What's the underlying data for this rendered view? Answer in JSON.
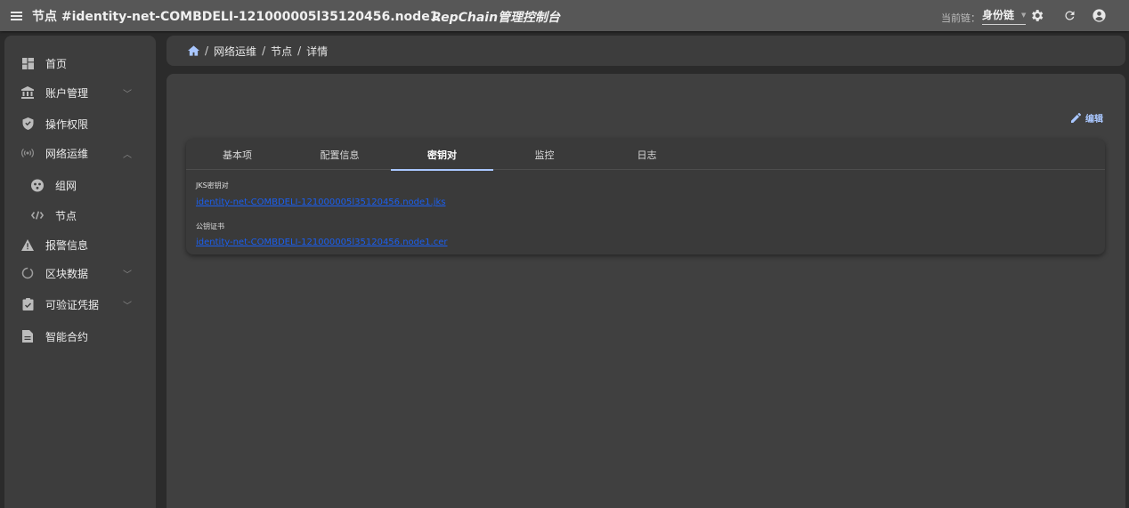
{
  "header": {
    "title": "节点 #identity-net-COMBDELI-121000005l35120456.node1",
    "brand": "RepChain管理控制台",
    "chain_label": "当前链：",
    "chain_value": "身份链"
  },
  "sidebar": {
    "items": [
      {
        "label": "首页",
        "icon": "dashboard-icon"
      },
      {
        "label": "账户管理",
        "icon": "bank-icon",
        "expandable": true
      },
      {
        "label": "操作权限",
        "icon": "shield-icon"
      },
      {
        "label": "网络运维",
        "icon": "broadcast-icon",
        "expandable": true,
        "expanded": true
      },
      {
        "label": "组网",
        "icon": "network-icon",
        "sub": true
      },
      {
        "label": "节点",
        "icon": "node-icon",
        "sub": true
      },
      {
        "label": "报警信息",
        "icon": "warning-icon"
      },
      {
        "label": "区块数据",
        "icon": "circle-icon",
        "expandable": true
      },
      {
        "label": "可验证凭据",
        "icon": "clipboard-check-icon",
        "expandable": true
      },
      {
        "label": "智能合约",
        "icon": "document-icon"
      }
    ]
  },
  "breadcrumb": [
    "网络运维",
    "节点",
    "详情"
  ],
  "content": {
    "edit_label": "编辑",
    "tabs": [
      "基本项",
      "配置信息",
      "密钥对",
      "监控",
      "日志"
    ],
    "active_tab": 2,
    "fields": [
      {
        "label": "JKS密钥对",
        "value": "identity-net-COMBDELI-121000005l35120456.node1.jks"
      },
      {
        "label": "公钥证书",
        "value": "identity-net-COMBDELI-121000005l35120456.node1.cer"
      }
    ]
  },
  "colors": {
    "accent": "#a9c7ff",
    "link": "#1a5ff0",
    "topbar": "#575757",
    "panel": "#3d3d3d"
  }
}
